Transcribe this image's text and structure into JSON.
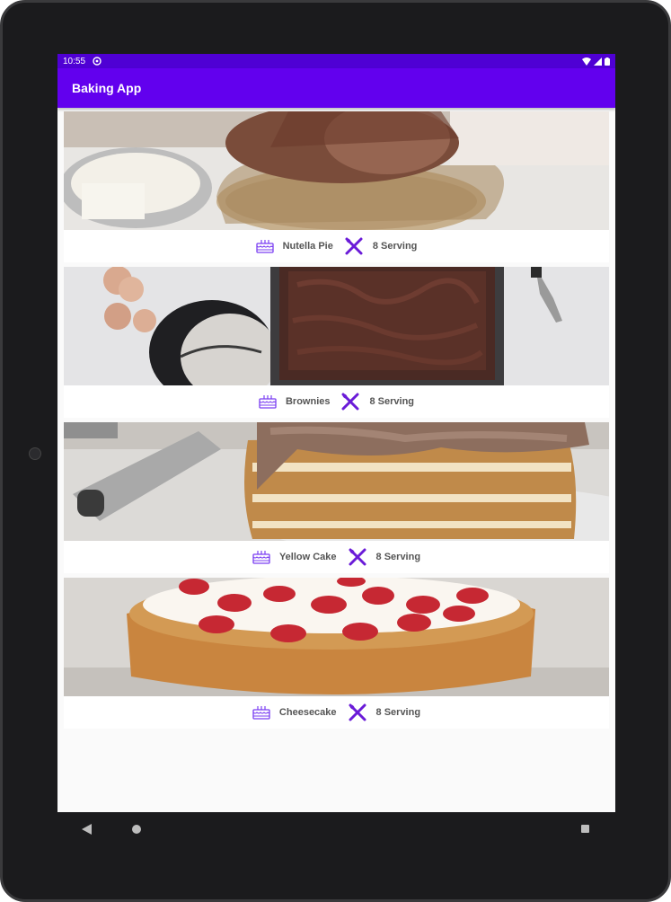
{
  "status_bar": {
    "time": "10:55"
  },
  "app_bar": {
    "title": "Baking App"
  },
  "recipes": [
    {
      "name": "Nutella Pie",
      "servings": "8 Serving"
    },
    {
      "name": "Brownies",
      "servings": "8 Serving"
    },
    {
      "name": "Yellow Cake",
      "servings": "8 Serving"
    },
    {
      "name": "Cheesecake",
      "servings": "8 Serving"
    }
  ],
  "icons": {
    "cake": "cake-icon",
    "cutlery": "cutlery-icon"
  },
  "colors": {
    "primary": "#6200ee",
    "status_bar": "#4f00d4",
    "icon_accent": "#6200ee"
  }
}
